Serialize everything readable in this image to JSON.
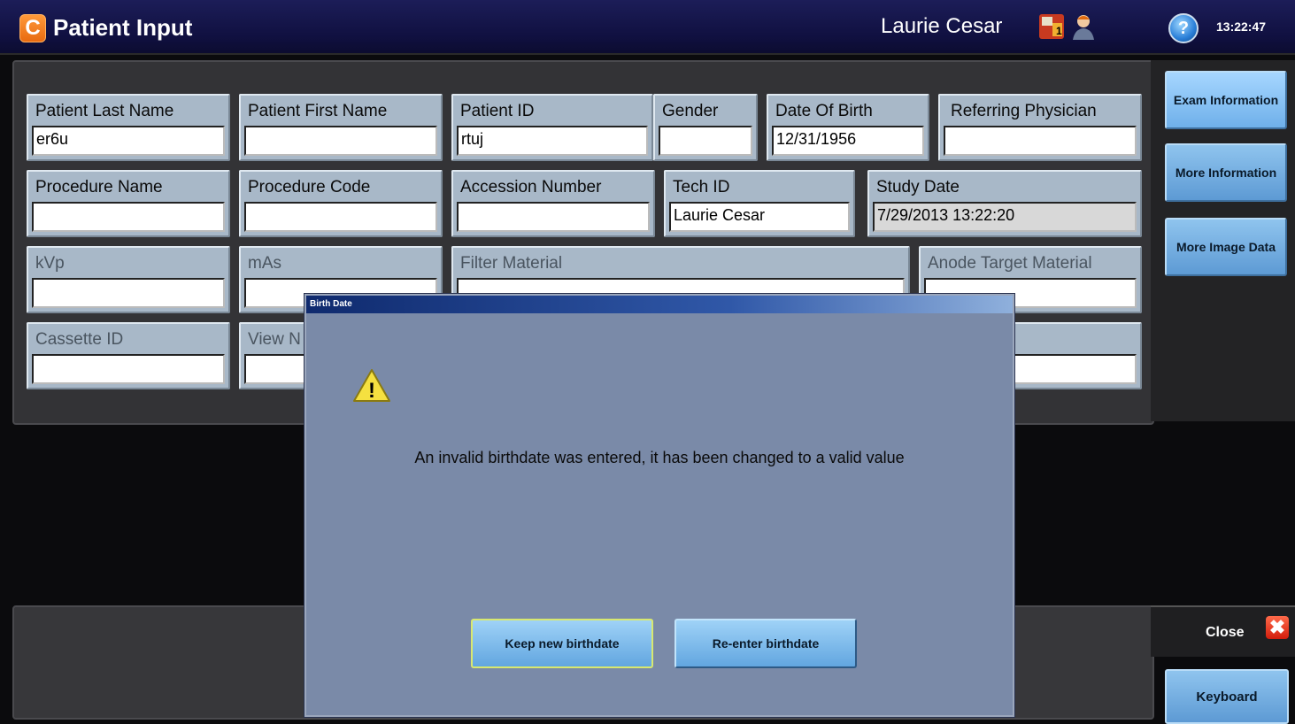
{
  "header": {
    "app_logo": "C",
    "title": "Patient Input",
    "user": "Laurie Cesar",
    "help_glyph": "?",
    "time": "13:22:47",
    "icons": [
      "worklist-icon",
      "technologist-icon",
      "help-icon"
    ]
  },
  "fields": {
    "last_name": {
      "label": "Patient Last Name",
      "value": "er6u"
    },
    "first_name": {
      "label": "Patient First Name",
      "value": ""
    },
    "patient_id": {
      "label": "Patient ID",
      "value": "rtuj"
    },
    "gender": {
      "label": "Gender",
      "value": ""
    },
    "dob": {
      "label": "Date Of Birth",
      "value": "12/31/1956"
    },
    "ref_phys": {
      "label": "Referring Physician",
      "value": ""
    },
    "proc_name": {
      "label": "Procedure Name",
      "value": ""
    },
    "proc_code": {
      "label": "Procedure Code",
      "value": ""
    },
    "accession": {
      "label": "Accession Number",
      "value": ""
    },
    "tech_id": {
      "label": "Tech ID",
      "value": "Laurie Cesar"
    },
    "study_date": {
      "label": "Study Date",
      "value": "7/29/2013 13:22:20"
    },
    "kvp": {
      "label": "kVp",
      "value": ""
    },
    "mas": {
      "label": "mAs",
      "value": ""
    },
    "filter": {
      "label": "Filter Material",
      "value": ""
    },
    "anode": {
      "label": "Anode Target Material",
      "value": ""
    },
    "cassette": {
      "label": "Cassette ID",
      "value": ""
    },
    "view": {
      "label": "View N",
      "value": ""
    }
  },
  "side": {
    "exam": "Exam Information",
    "more_info": "More Information",
    "more_image": "More Image Data",
    "close": "Close",
    "close_glyph": "✖",
    "keyboard": "Keyboard"
  },
  "dialog": {
    "title": "Birth Date",
    "message": "An invalid birthdate was entered, it has been changed to a valid value",
    "keep": "Keep new birthdate",
    "reenter": "Re-enter birthdate",
    "warning_glyph": "!"
  },
  "colors": {
    "titlebar": "#101040",
    "field_bg": "#a8b8c8",
    "button": "#6fb0ea",
    "dialog_bg": "#7a8aa8"
  }
}
